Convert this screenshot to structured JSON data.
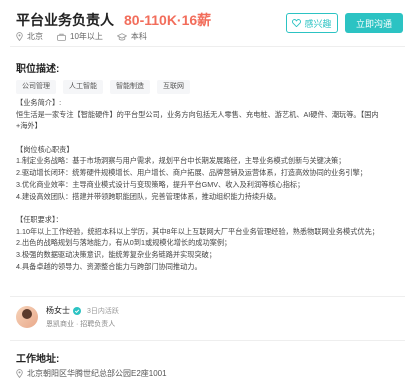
{
  "job": {
    "title": "平台业务负责人",
    "salary": "80-110K·16薪",
    "city": "北京",
    "experience": "10年以上",
    "education": "本科"
  },
  "actions": {
    "interest_label": "感兴趣",
    "chat_label": "立即沟通"
  },
  "sections": {
    "description_title": "职位描述:",
    "address_title": "工作地址:"
  },
  "tags": [
    "公司管理",
    "人工智能",
    "智能制造",
    "互联网"
  ],
  "description": {
    "intro_heading": "【业务简介】:",
    "intro_lines": [
      "恒生活是一家专注【智能硬件】的平台型公司，业务方向包括无人零售、充电桩、游艺机、AI硬件、潮玩等。【国内",
      "+海外】"
    ],
    "duties_heading": "【岗位核心职责】",
    "duties": [
      "1.制定业务战略：基于市场洞察与用户需求，规划平台中长期发展路径，主导业务模式创新与关键决策；",
      "2.驱动增长闭环：统筹硬件规模增长、用户增长、商户拓展、品牌营销及运营体系，打造高效协同的业务引擎；",
      "3.优化商业效率：主导商业模式设计与变现策略，提升平台GMV、收入及利润等核心指标；",
      "4.建设高效团队：搭建并带领跨职能团队，完善管理体系，推动组织能力持续升级。"
    ],
    "requirements_heading": "【任职要求】：",
    "requirements": [
      "1.10年以上工作经验，统招本科以上学历，其中8年以上互联网大厂平台业务管理经验，熟悉物联网业务模式优先；",
      "2.出色的战略规划与落地能力，有从0到1或规模化增长的成功案例；",
      "3.极强的数据驱动决策意识，能统筹复杂业务链路并实现突破；",
      "4.具备卓越的领导力、资源整合能力与跨部门协同推动力。"
    ]
  },
  "recruiter": {
    "name": "杨女士",
    "active": "3日内活跃",
    "title": "恩凯商业 · 招聘负责人"
  },
  "address": "北京朝阳区华腾世纪总部公园E2座1001",
  "colors": {
    "accent": "#2cc3c3",
    "salary": "#f26d5b"
  }
}
